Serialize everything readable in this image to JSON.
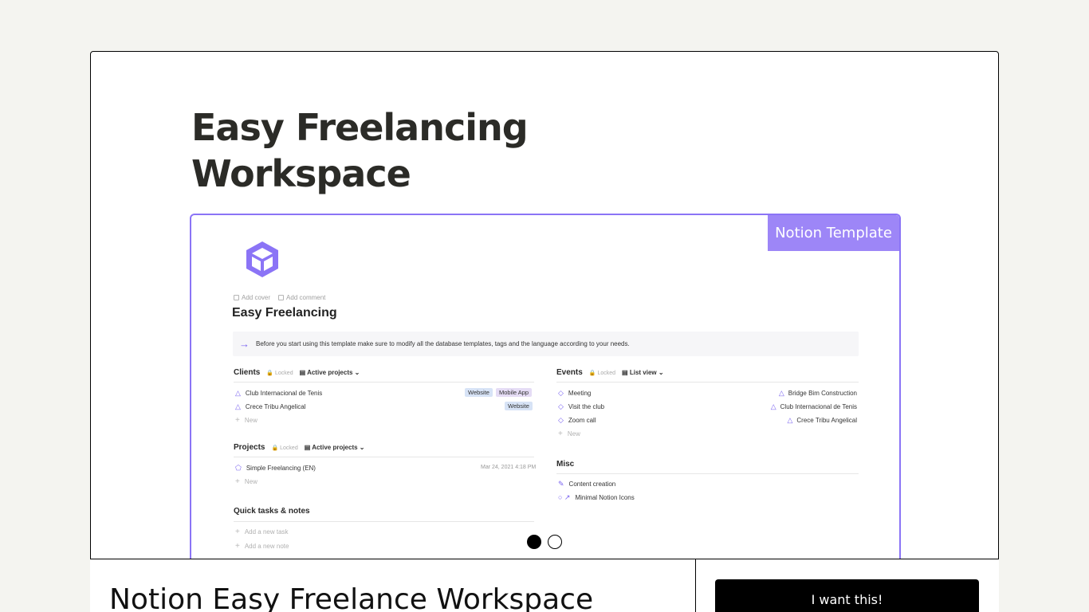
{
  "hero": {
    "title_line1": "Easy Freelancing",
    "title_line2": "Workspace"
  },
  "badge": {
    "label": "Notion Template"
  },
  "notion": {
    "meta": {
      "add_cover": "Add cover",
      "add_comment": "Add comment"
    },
    "title": "Easy Freelancing",
    "callout": "Before you start using this template make sure to modify all the database templates, tags and the language according to your needs.",
    "clients": {
      "heading": "Clients",
      "locked": "Locked",
      "view": "Active projects",
      "rows": [
        {
          "name": "Club Internacional de Tenis",
          "tags": [
            "Website",
            "Mobile App"
          ]
        },
        {
          "name": "Crece Tribu Angelical",
          "tags": [
            "Website"
          ]
        }
      ],
      "new_label": "New"
    },
    "projects": {
      "heading": "Projects",
      "locked": "Locked",
      "view": "Active projects",
      "rows": [
        {
          "name": "Simple Freelancing (EN)",
          "date": "Mar 24, 2021 4:18 PM"
        }
      ],
      "new_label": "New"
    },
    "quick": {
      "heading": "Quick tasks & notes",
      "add_task": "Add a new task",
      "add_note": "Add a new note"
    },
    "events": {
      "heading": "Events",
      "locked": "Locked",
      "view": "List view",
      "rows": [
        {
          "name": "Meeting",
          "client": "Bridge Bim Construction"
        },
        {
          "name": "Visit the club",
          "client": "Club Internacional de Tenis"
        },
        {
          "name": "Zoom call",
          "client": "Crece Tribu Angelical"
        }
      ],
      "new_label": "New"
    },
    "misc": {
      "heading": "Misc",
      "items": [
        "Content creation",
        "Minimal Notion Icons"
      ]
    }
  },
  "product": {
    "title": "Notion Easy Freelance Workspace"
  },
  "cta": {
    "label": "I want this!"
  },
  "colors": {
    "accent": "#8b74f6",
    "ribbon": "#9d86f7",
    "background": "#f4f4f0"
  }
}
